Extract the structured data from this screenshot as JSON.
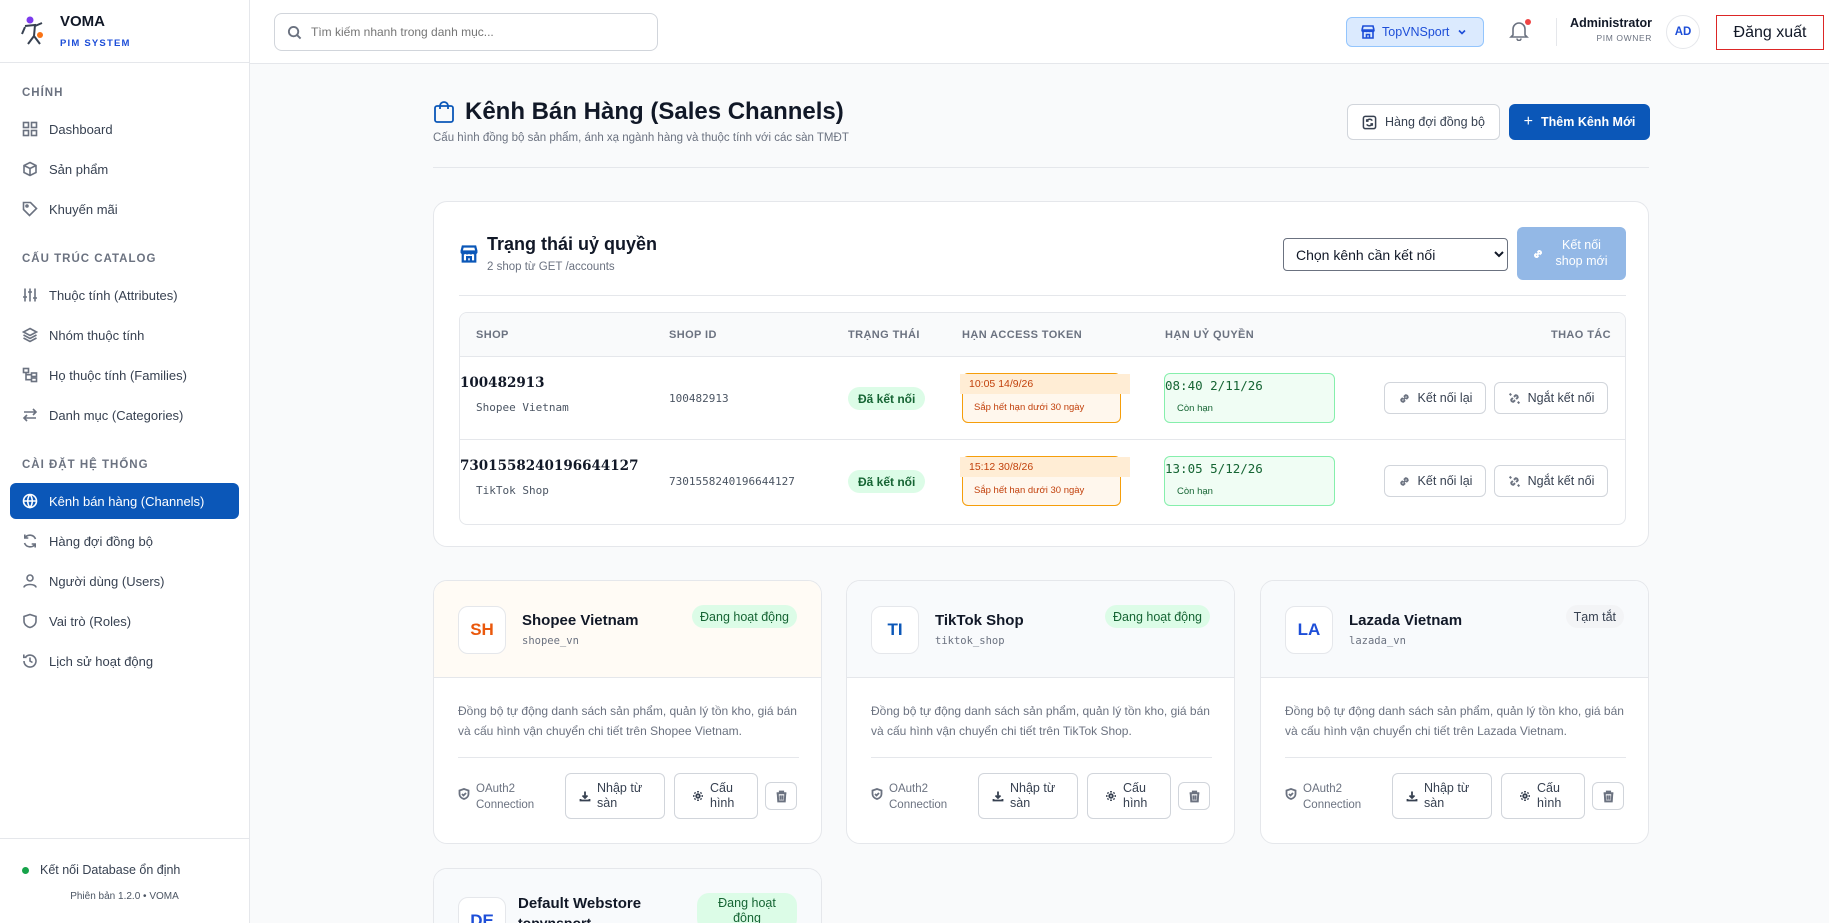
{
  "brand": {
    "name": "VOMA",
    "subtitle": "PIM SYSTEM"
  },
  "sidebar": {
    "sections": [
      {
        "title": "CHÍNH",
        "items": [
          {
            "label": "Dashboard",
            "icon": "grid-icon"
          },
          {
            "label": "Sản phẩm",
            "icon": "box-icon"
          },
          {
            "label": "Khuyến mãi",
            "icon": "tag-icon"
          }
        ]
      },
      {
        "title": "CẤU TRÚC CATALOG",
        "items": [
          {
            "label": "Thuộc tính (Attributes)",
            "icon": "sliders-icon"
          },
          {
            "label": "Nhóm thuộc tính",
            "icon": "layers-icon"
          },
          {
            "label": "Họ thuộc tính (Families)",
            "icon": "hierarchy-icon"
          },
          {
            "label": "Danh mục (Categories)",
            "icon": "arrows-icon"
          }
        ]
      },
      {
        "title": "CÀI ĐẶT HỆ THỐNG",
        "items": [
          {
            "label": "Kênh bán hàng (Channels)",
            "icon": "globe-icon",
            "active": true
          },
          {
            "label": "Hàng đợi đồng bộ",
            "icon": "refresh-icon"
          },
          {
            "label": "Người dùng (Users)",
            "icon": "user-icon"
          },
          {
            "label": "Vai trò (Roles)",
            "icon": "shield-icon"
          },
          {
            "label": "Lịch sử hoạt động",
            "icon": "history-icon"
          }
        ]
      }
    ],
    "db_status": "Kết nối Database ổn định",
    "version": "Phiên bản 1.2.0 • VOMA"
  },
  "topbar": {
    "search_placeholder": "Tìm kiếm nhanh trong danh mục...",
    "tenant": "TopVNSport",
    "user_name": "Administrator",
    "user_role": "PIM OWNER",
    "avatar": "AD",
    "logout": "Đăng xuất"
  },
  "page": {
    "title": "Kênh Bán Hàng (Sales Channels)",
    "subtitle": "Cấu hình đồng bộ sản phẩm, ánh xạ ngành hàng và thuộc tính với các sàn TMĐT",
    "queue_button": "Hàng đợi đồng bộ",
    "add_button": "Thêm Kênh Mới"
  },
  "auth": {
    "title": "Trạng thái uỷ quyền",
    "subtitle": "2 shop từ GET /accounts",
    "select_value": "Chọn kênh cần kết nối",
    "connect_button": "Kết nối shop mới",
    "columns": [
      "SHOP",
      "SHOP ID",
      "TRẠNG THÁI",
      "HẠN ACCESS TOKEN",
      "HẠN UỶ QUYỀN",
      "THAO TÁC"
    ],
    "rows": [
      {
        "shop": "100482913",
        "channel": "Shopee Vietnam",
        "shop_id": "100482913",
        "status": "Đã kết nối",
        "token_time": "10:05 14/9/26",
        "token_note": "Sắp hết hạn dưới 30 ngày",
        "auth_time": "08:40 2/11/26",
        "auth_note": "Còn hạn",
        "reconnect": "Kết nối lại",
        "disconnect": "Ngắt kết nối"
      },
      {
        "shop": "7301558240196644127",
        "channel": "TikTok Shop",
        "shop_id": "7301558240196644127",
        "status": "Đã kết nối",
        "token_time": "15:12 30/8/26",
        "token_note": "Sắp hết hạn dưới 30 ngày",
        "auth_time": "13:05 5/12/26",
        "auth_note": "Còn hạn",
        "reconnect": "Kết nối lại",
        "disconnect": "Ngắt kết nối"
      }
    ]
  },
  "channels": [
    {
      "abbr": "SH",
      "name": "Shopee Vietnam",
      "code": "shopee_vn",
      "badge": "Đang hoạt động",
      "desc": "Đồng bộ tự động danh sách sản phẩm, quản lý tồn kho, giá bán và cấu hình vận chuyển chi tiết trên Shopee Vietnam.",
      "oauth": "OAuth2 Connection",
      "import": "Nhập từ sàn",
      "config": "Cấu hình",
      "color": "#ea580c",
      "bg": "#fffbf5"
    },
    {
      "abbr": "TI",
      "name": "TikTok Shop",
      "code": "tiktok_shop",
      "badge": "Đang hoạt động",
      "desc": "Đồng bộ tự động danh sách sản phẩm, quản lý tồn kho, giá bán và cấu hình vận chuyển chi tiết trên TikTok Shop.",
      "oauth": "OAuth2 Connection",
      "import": "Nhập từ sàn",
      "config": "Cấu hình",
      "color": "#111827",
      "bg": "#f8fafc"
    },
    {
      "abbr": "LA",
      "name": "Lazada Vietnam",
      "code": "lazada_vn",
      "badge": "Tạm tắt",
      "desc": "Đồng bộ tự động danh sách sản phẩm, quản lý tồn kho, giá bán và cấu hình vận chuyển chi tiết trên Lazada Vietnam.",
      "oauth": "OAuth2 Connection",
      "import": "Nhập từ sàn",
      "config": "Cấu hình",
      "color": "#1d4ed8",
      "bg": "#f8fafc"
    },
    {
      "abbr": "DE",
      "name": "Default Webstore",
      "code": "topvnsport",
      "badge": "Đang hoạt động",
      "color": "#1d4ed8",
      "bg": "#f8fafc"
    }
  ]
}
